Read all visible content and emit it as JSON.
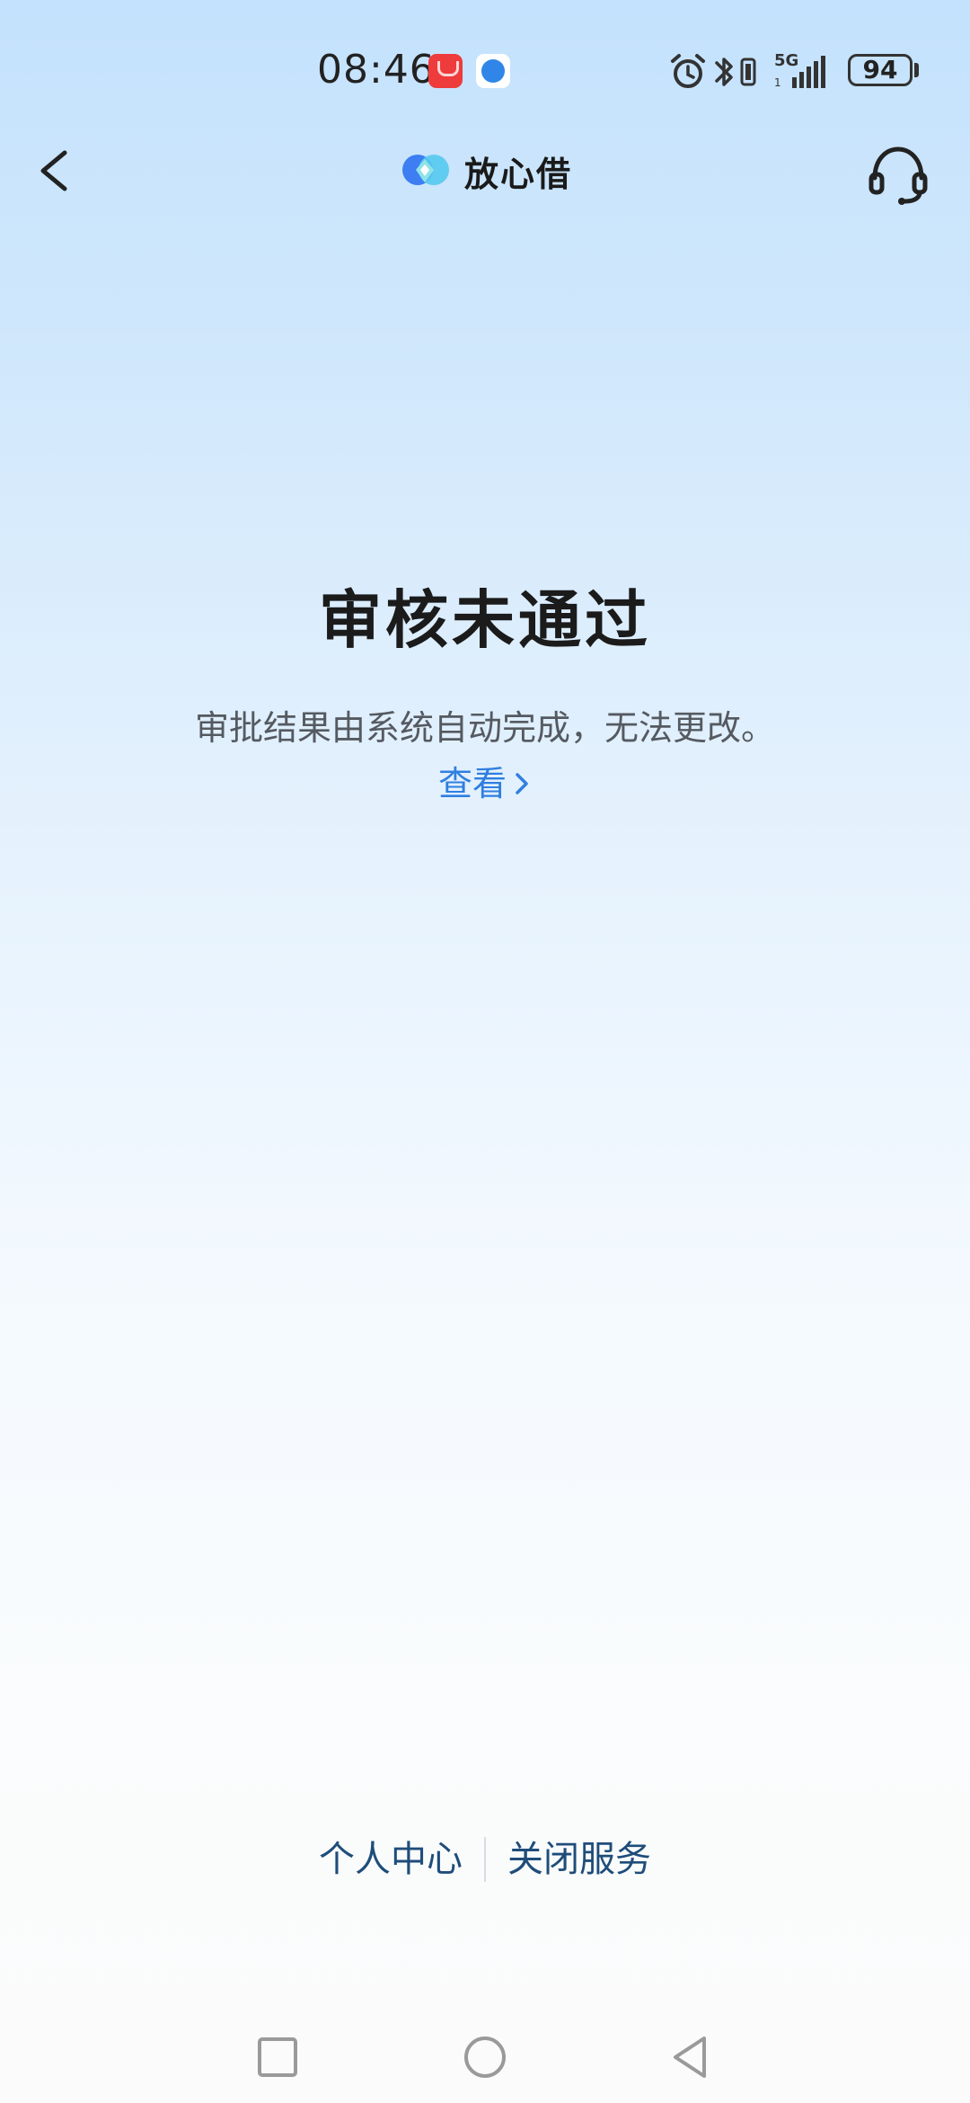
{
  "status_bar": {
    "time": "08:46",
    "battery": "94",
    "network": "5G",
    "icons": [
      "huawei-appgallery-icon",
      "browser-globe-icon",
      "alarm-icon",
      "bluetooth-icon",
      "vibrate-icon",
      "signal-icon"
    ]
  },
  "header": {
    "brand_name": "放心借",
    "back_icon": "chevron-left-icon",
    "service_icon": "headset-icon"
  },
  "main": {
    "title": "审核未通过",
    "description": "审批结果由系统自动完成，无法更改。",
    "view_link": "查看"
  },
  "footer": {
    "links": [
      "个人中心",
      "关闭服务"
    ]
  },
  "system_nav": {
    "icons": [
      "recents-square-icon",
      "home-circle-icon",
      "back-triangle-icon"
    ]
  },
  "colors": {
    "link_blue": "#2f7fe0",
    "footer_link": "#1f4d7a",
    "title": "#1b1b1b",
    "description": "#555a61"
  }
}
